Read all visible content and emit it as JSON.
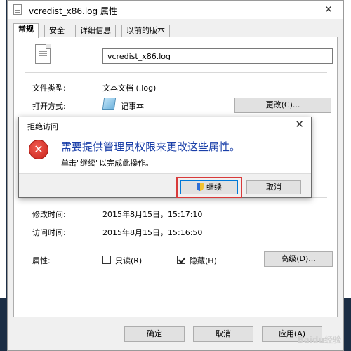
{
  "window": {
    "title": "vcredist_x86.log 属性",
    "close_glyph": "✕"
  },
  "tabs": [
    {
      "label": "常规",
      "active": true
    },
    {
      "label": "安全",
      "active": false
    },
    {
      "label": "详细信息",
      "active": false
    },
    {
      "label": "以前的版本",
      "active": false
    }
  ],
  "general": {
    "file_name": "vcredist_x86.log",
    "file_type_label": "文件类型:",
    "file_type_value": "文本文档 (.log)",
    "open_with_label": "打开方式:",
    "open_with_value": "记事本",
    "change_button": "更改(C)...",
    "modified_label": "修改时间:",
    "modified_value": "2015年8月15日，15:17:10",
    "accessed_label": "访问时间:",
    "accessed_value": "2015年8月15日，15:16:50",
    "attributes_label": "属性:",
    "readonly_label": "只读(R)",
    "readonly_checked": false,
    "hidden_label": "隐藏(H)",
    "hidden_checked": true,
    "advanced_button": "高级(D)..."
  },
  "dialog": {
    "title": "拒绝访问",
    "close_glyph": "✕",
    "heading": "需要提供管理员权限来更改这些属性。",
    "message": "单击\"继续\"以完成此操作。",
    "continue_button": "继续",
    "cancel_button": "取消",
    "error_glyph": "✕"
  },
  "footer": {
    "ok_button": "确定",
    "cancel_button": "取消",
    "apply_button": "应用(A)"
  },
  "watermark": "Baidu经验",
  "colors": {
    "dialog_heading": "#1a3fa8",
    "error_red": "#d9342b",
    "highlight_box": "#d83a3a"
  }
}
